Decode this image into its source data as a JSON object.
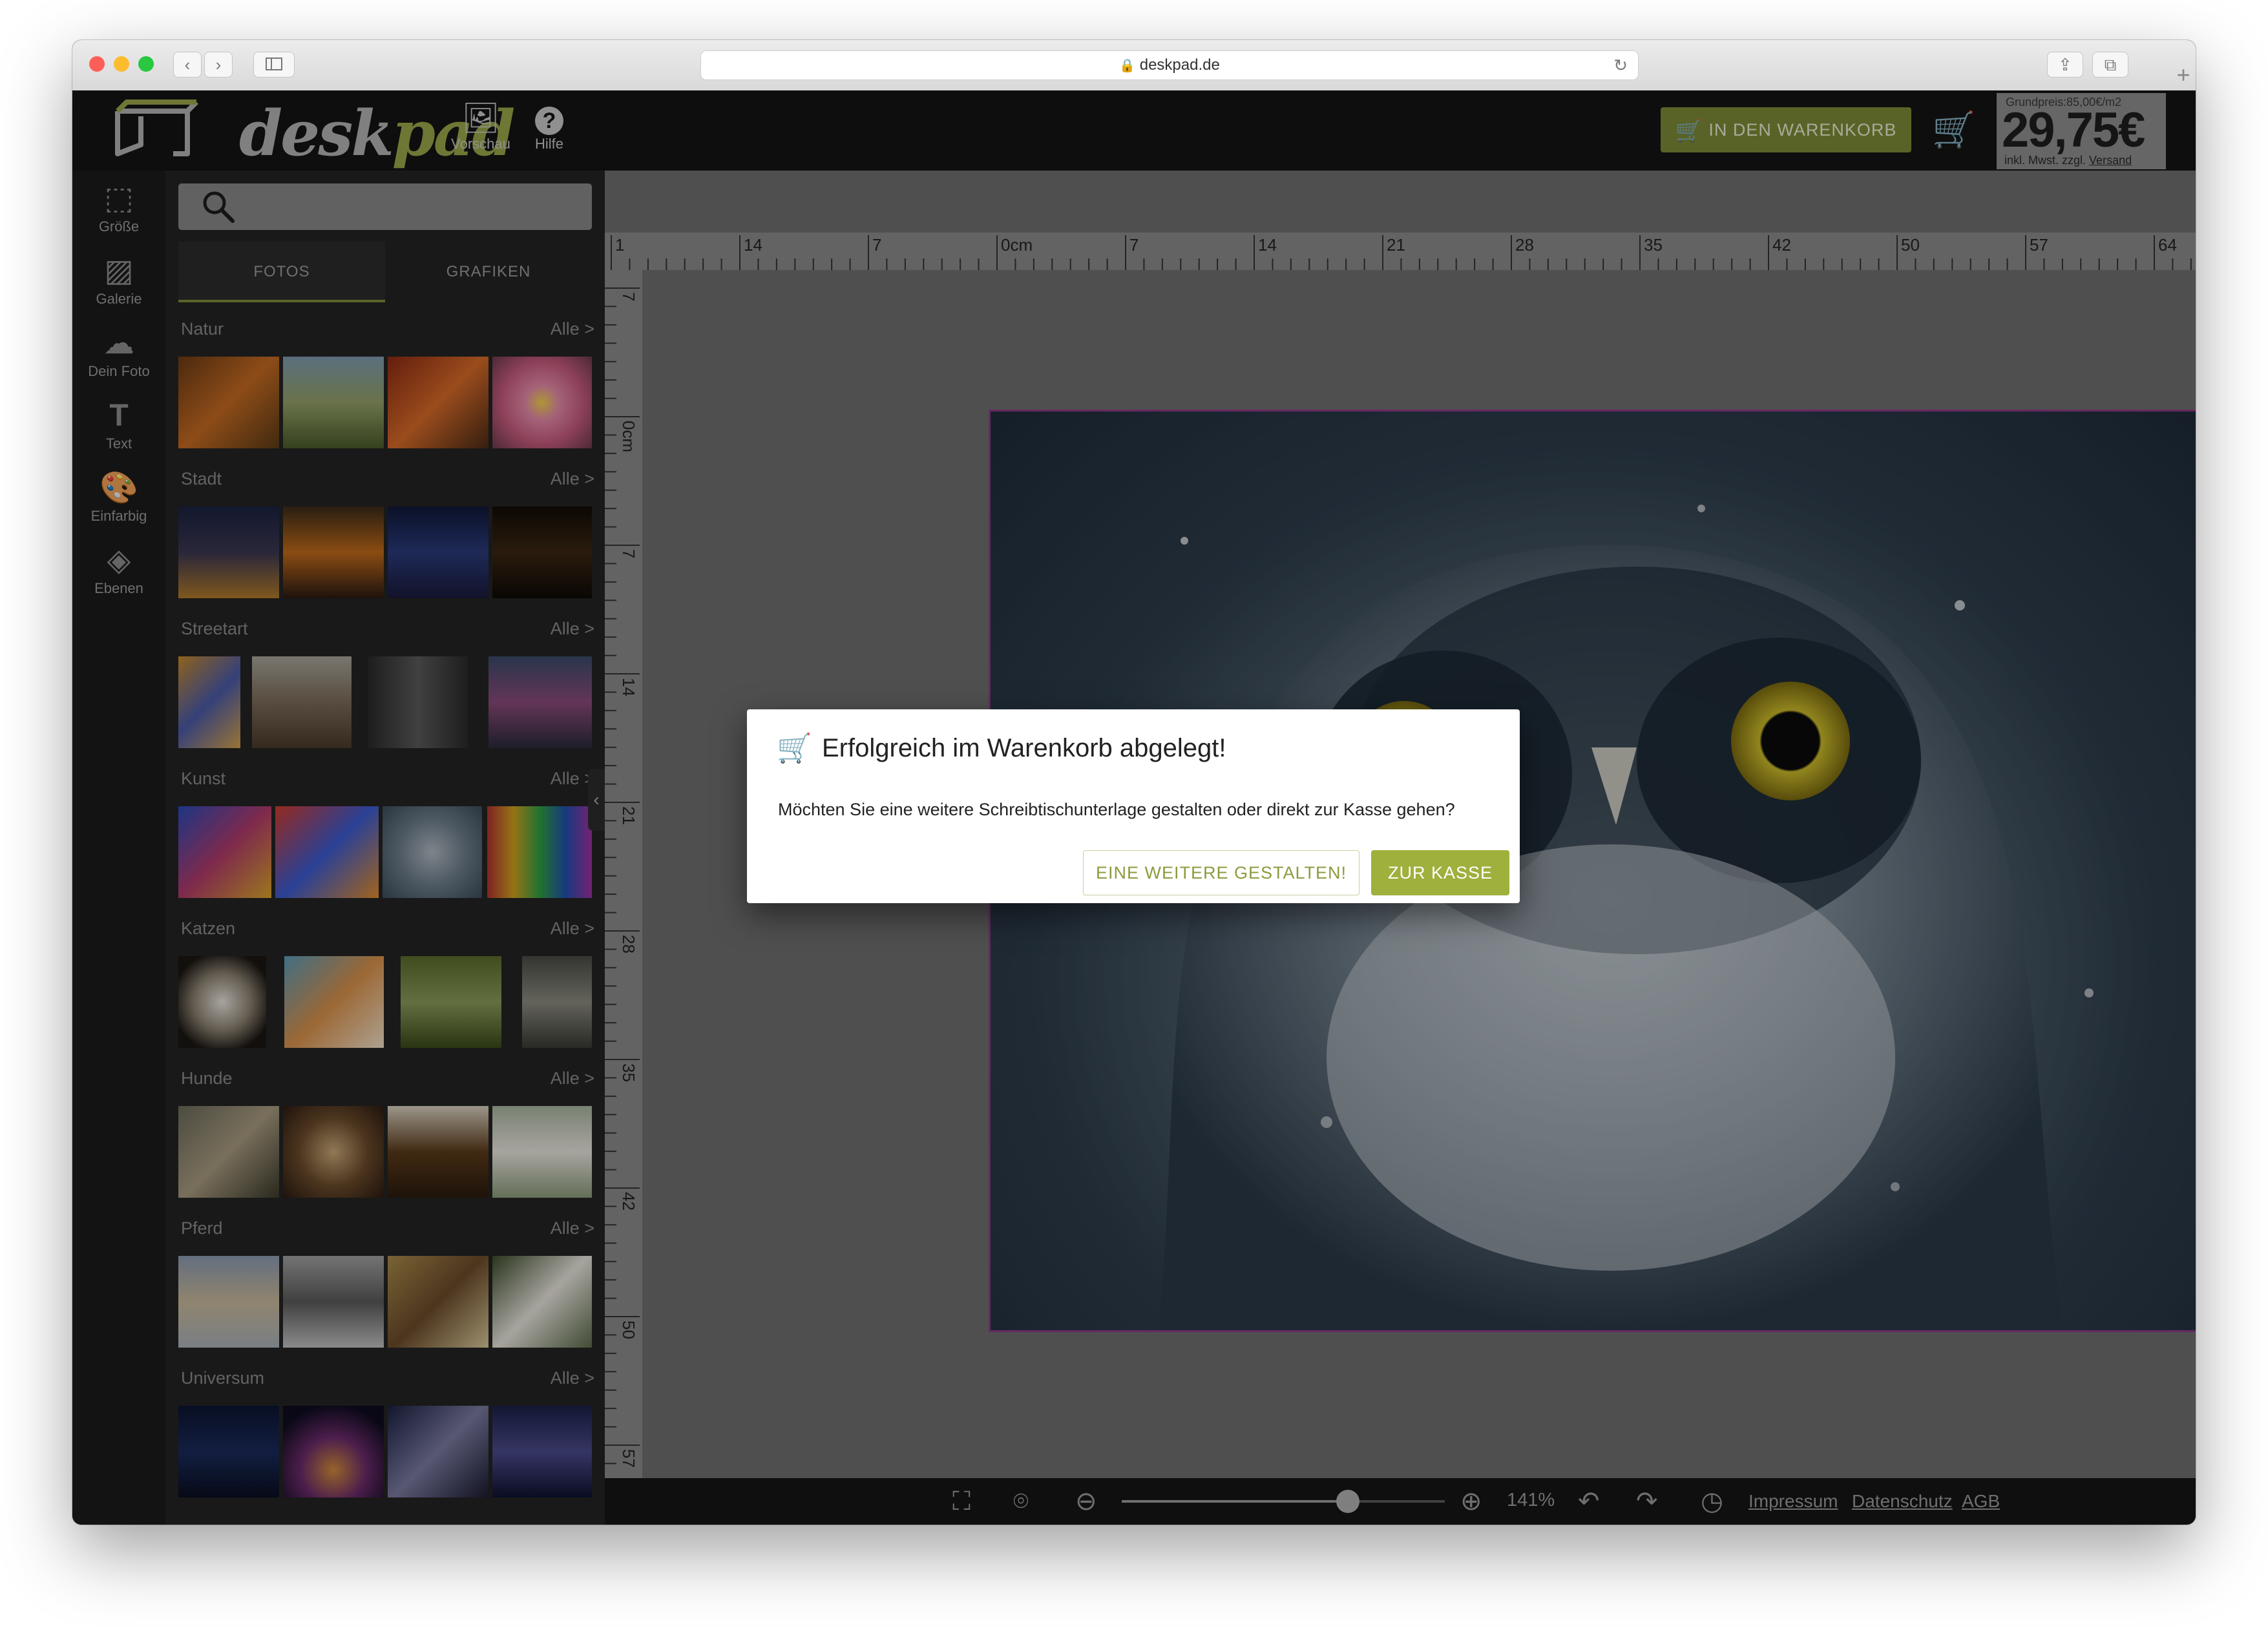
{
  "browser": {
    "url": "deskpad.de"
  },
  "header": {
    "logo_text_a": "desk",
    "logo_text_b": "pad",
    "preview_label": "Vorschau",
    "help_label": "Hilfe",
    "cart_button": "IN DEN WARENKORB",
    "price": {
      "base": "Grundpreis:85,00€/m2",
      "value": "29,75€",
      "note": "inkl. Mwst. zzgl.",
      "shipping_link": "Versand"
    }
  },
  "leftbar": {
    "items": [
      {
        "label": "Größe",
        "icon": "size-icon"
      },
      {
        "label": "Galerie",
        "icon": "gallery-icon"
      },
      {
        "label": "Dein Foto",
        "icon": "upload-icon"
      },
      {
        "label": "Text",
        "icon": "text-icon"
      },
      {
        "label": "Einfarbig",
        "icon": "palette-icon"
      },
      {
        "label": "Ebenen",
        "icon": "layers-icon"
      }
    ]
  },
  "gallery": {
    "tabs": [
      "FOTOS",
      "GRAFIKEN"
    ],
    "all_label": "Alle >",
    "categories": [
      "Natur",
      "Stadt",
      "Streetart",
      "Kunst",
      "Katzen",
      "Hunde",
      "Pferd",
      "Universum"
    ]
  },
  "ruler": {
    "h_labels": [
      "1",
      "14",
      "7",
      "0cm",
      "7",
      "14",
      "21",
      "28",
      "35",
      "42",
      "50",
      "57",
      "64"
    ],
    "v_labels": [
      "7",
      "0cm",
      "7",
      "14",
      "21",
      "28",
      "35",
      "42",
      "50",
      "57"
    ]
  },
  "bottombar": {
    "zoom": "141%",
    "zoom_level": 0.7,
    "links": [
      "Impressum",
      "Datenschutz",
      "AGB"
    ]
  },
  "modal": {
    "title": "Erfolgreich im Warenkorb abgelegt!",
    "text": "Möchten Sie eine weitere Schreibtischunterlage gestalten oder direkt zur Kasse gehen?",
    "secondary_button": "EINE WEITERE GESTALTEN!",
    "primary_button": "ZUR KASSE"
  },
  "colors": {
    "accent": "#9fb03c",
    "header_bg": "#141414",
    "panel_bg": "#232323"
  }
}
